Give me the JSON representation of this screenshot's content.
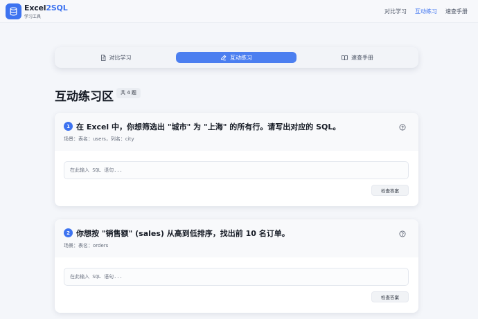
{
  "header": {
    "brand_main": "Excel",
    "brand_accent": "2SQL",
    "brand_sub": "学习工具",
    "nav": [
      {
        "label": "对比学习"
      },
      {
        "label": "互动练习"
      },
      {
        "label": "速查手册"
      }
    ],
    "active_nav": "互动练习",
    "accent_color": "#3d73f0"
  },
  "tabs": [
    {
      "label": "对比学习",
      "icon": "document-icon"
    },
    {
      "label": "互动练习",
      "icon": "pen-icon"
    },
    {
      "label": "速查手册",
      "icon": "book-icon"
    }
  ],
  "active_tab": "互动练习",
  "section": {
    "title": "互动练习区",
    "count_badge": "共 4 题"
  },
  "questions": [
    {
      "number": "1",
      "text": "在 Excel 中，你想筛选出 \"城市\" 为 \"上海\" 的所有行。请写出对应的 SQL。",
      "scene": "场景：表名：users，列名：city",
      "input_value": "",
      "placeholder": "在此输入 SQL 语句...",
      "button_label": "检查答案"
    },
    {
      "number": "2",
      "text": "你想按 \"销售额\" (sales) 从高到低排序，找出前 10 名订单。",
      "scene": "场景：表名：orders",
      "input_value": "",
      "placeholder": "在此输入 SQL 语句...",
      "button_label": "检查答案"
    }
  ]
}
